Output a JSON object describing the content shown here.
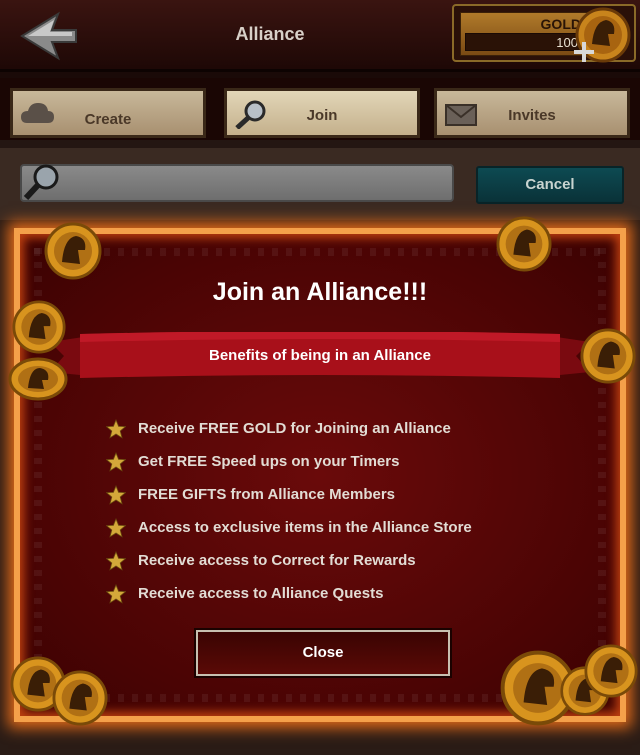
{
  "header": {
    "title": "Alliance",
    "gold_label": "GOLD",
    "gold_value": "100"
  },
  "tabs": [
    {
      "label": "Create",
      "icon": "cloud-icon",
      "active": false
    },
    {
      "label": "Join",
      "icon": "magnifier-icon",
      "active": true
    },
    {
      "label": "Invites",
      "icon": "envelope-icon",
      "active": false
    }
  ],
  "search": {
    "value": "",
    "placeholder": "",
    "cancel_label": "Cancel"
  },
  "modal": {
    "title": "Join an Alliance!!!",
    "subtitle": "Benefits of being in an Alliance",
    "benefits": [
      "Receive FREE GOLD for Joining an Alliance",
      "Get FREE Speed ups on your Timers",
      "FREE GIFTS from Alliance Members",
      "Access to exclusive items in the Alliance Store",
      "Receive access to Correct for Rewards",
      "Receive access to Alliance Quests"
    ],
    "close_label": "Close"
  },
  "colors": {
    "modal_bg": "#4a0404",
    "modal_border": "#f4a04a",
    "cancel_bg": "#0d4a52",
    "star": "#d4a83a",
    "ribbon": "#a8101a"
  }
}
